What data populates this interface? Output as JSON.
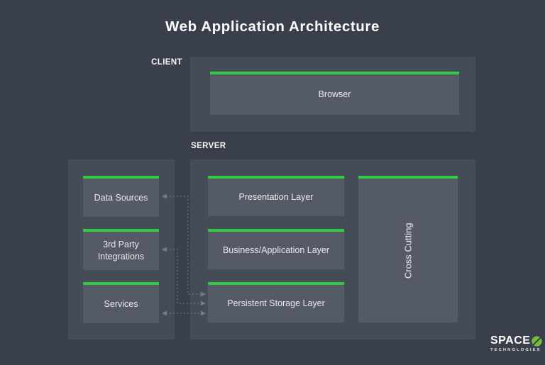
{
  "page": {
    "title": "Web Application Architecture"
  },
  "client_section": {
    "label": "CLIENT",
    "browser_label": "Browser"
  },
  "server_section": {
    "label": "SERVER",
    "layers": [
      {
        "label": "Presentation Layer"
      },
      {
        "label": "Business/Application Layer"
      },
      {
        "label": "Persistent Storage Layer"
      }
    ],
    "cross_cutting_label": "Cross Cutting"
  },
  "external_section": {
    "boxes": [
      {
        "label": "Data Sources"
      },
      {
        "label": "3rd Party Integrations"
      },
      {
        "label": "Services"
      }
    ]
  },
  "connections": [
    {
      "from": "Persistent Storage Layer",
      "to": "Data Sources",
      "style": "dashed",
      "arrows": "both"
    },
    {
      "from": "Persistent Storage Layer",
      "to": "3rd Party Integrations",
      "style": "dashed",
      "arrows": "both"
    },
    {
      "from": "Persistent Storage Layer",
      "to": "Services",
      "style": "dashed",
      "arrows": "both"
    }
  ],
  "logo": {
    "name": "SPACE",
    "o_icon": "slashed-o-icon",
    "subtitle": "TECHNOLOGIES"
  },
  "colors": {
    "page_bg": "#3a404b",
    "panel_bg": "#454b57",
    "box_bg": "#545b66",
    "accent_green": "#2fcb41",
    "logo_green": "#72bf3b",
    "connector": "#79828f",
    "text": "#f2f4f6"
  }
}
